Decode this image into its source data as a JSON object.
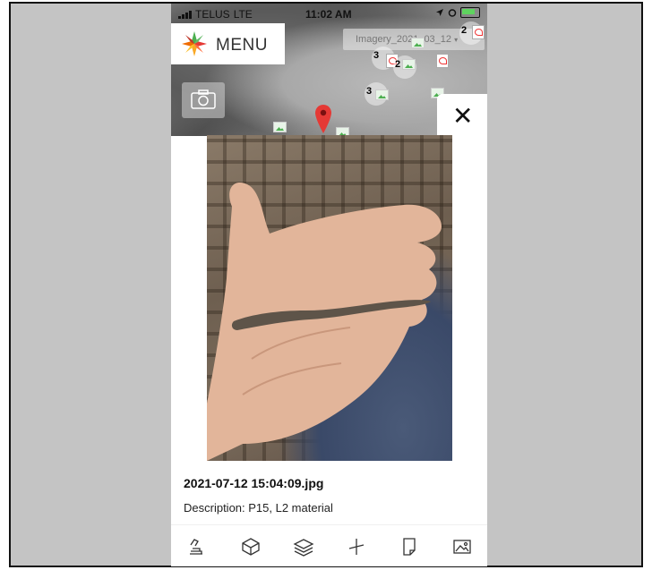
{
  "status_bar": {
    "carrier": "TELUS",
    "network": "LTE",
    "time": "11:02 AM"
  },
  "header": {
    "menu_label": "MENU"
  },
  "imagery_select": {
    "label": "Imagery_2021_03_12"
  },
  "map": {
    "clusters": [
      {
        "count": "2"
      },
      {
        "count": "3"
      },
      {
        "count": "2"
      },
      {
        "count": "3"
      }
    ]
  },
  "close": {
    "glyph": "✕"
  },
  "photo_caption": {
    "filename": "2021-07-12 15:04:09.jpg",
    "description": "Description: P15, L2 material"
  },
  "toolbar": {
    "icons": [
      "excavator-icon",
      "box-3d-icon",
      "layers-icon",
      "plus-crosshair-icon",
      "document-icon",
      "image-icon"
    ]
  },
  "colors": {
    "accent_green": "#4caf50",
    "pin_red": "#e53935",
    "background_gray": "#c4c4c4"
  }
}
